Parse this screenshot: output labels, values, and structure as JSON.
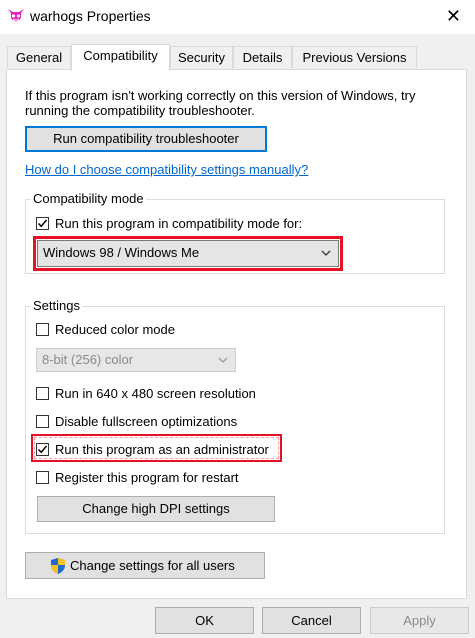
{
  "window": {
    "title": "warhogs Properties",
    "icon": "demon-mask-icon",
    "close_glyph": "✕"
  },
  "tabs": [
    {
      "label": "General",
      "active": false
    },
    {
      "label": "Compatibility",
      "active": true
    },
    {
      "label": "Security",
      "active": false
    },
    {
      "label": "Details",
      "active": false
    },
    {
      "label": "Previous Versions",
      "active": false
    }
  ],
  "compat": {
    "intro": "If this program isn't working correctly on this version of Windows, try running the compatibility troubleshooter.",
    "troubleshooter_button": "Run compatibility troubleshooter",
    "manual_link": "How do I choose compatibility settings manually?",
    "mode_group": {
      "label": "Compatibility mode",
      "run_in_mode_label": "Run this program in compatibility mode for:",
      "run_in_mode_checked": true,
      "os_select_value": "Windows 98 / Windows Me"
    },
    "settings_group": {
      "label": "Settings",
      "reduced_color_label": "Reduced color mode",
      "reduced_color_checked": false,
      "color_select_value": "8-bit (256) color",
      "res_640_label": "Run in 640 x 480 screen resolution",
      "res_640_checked": false,
      "disable_fullscreen_label": "Disable fullscreen optimizations",
      "disable_fullscreen_checked": false,
      "run_as_admin_label": "Run this program as an administrator",
      "run_as_admin_checked": true,
      "register_restart_label": "Register this program for restart",
      "register_restart_checked": false,
      "high_dpi_button": "Change high DPI settings"
    },
    "all_users_button": "Change settings for all users"
  },
  "footer": {
    "ok": "OK",
    "cancel": "Cancel",
    "apply": "Apply"
  },
  "colors": {
    "highlight_red": "#e81123",
    "link_blue": "#0066cc",
    "focus_blue": "#0078d7"
  }
}
